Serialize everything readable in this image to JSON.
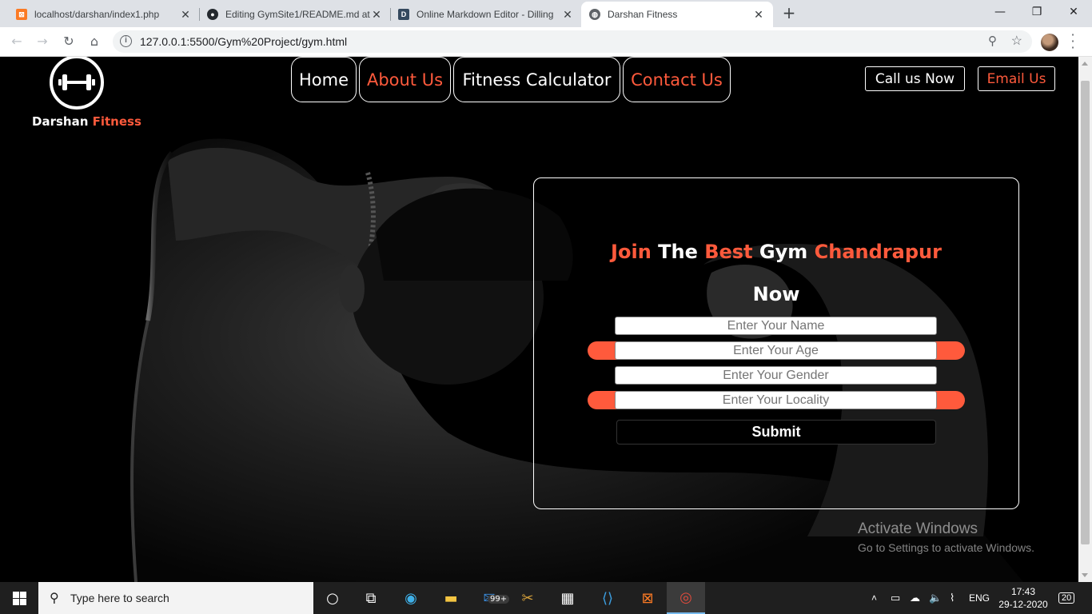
{
  "browser": {
    "tabs": [
      {
        "title": "localhost/darshan/index1.php",
        "active": false
      },
      {
        "title": "Editing GymSite1/README.md at",
        "active": false
      },
      {
        "title": "Online Markdown Editor - Dilling",
        "active": false
      },
      {
        "title": "Darshan Fitness",
        "active": true
      }
    ],
    "url": "127.0.0.1:5500/Gym%20Project/gym.html"
  },
  "site": {
    "brand_name": "Darshan",
    "brand_accent": "Fitness",
    "nav": [
      "Home",
      "About Us",
      "Fitness Calculator",
      "Contact Us"
    ],
    "cta": {
      "call": "Call us Now",
      "email": "Email Us"
    },
    "form": {
      "title_parts": [
        "Join",
        "The",
        "Best",
        "Gym",
        "Chandrapur",
        "Now"
      ],
      "placeholders": [
        "Enter Your Name",
        "Enter Your Age",
        "Enter Your Gender",
        "Enter Your Locality"
      ],
      "submit": "Submit"
    },
    "accent_color": "#ff5a3c"
  },
  "watermark": {
    "line1": "Activate Windows",
    "line2": "Go to Settings to activate Windows."
  },
  "taskbar": {
    "search_placeholder": "Type here to search",
    "mail_badge": "99+",
    "language": "ENG",
    "time": "17:43",
    "date": "29-12-2020",
    "notifications": "20"
  }
}
